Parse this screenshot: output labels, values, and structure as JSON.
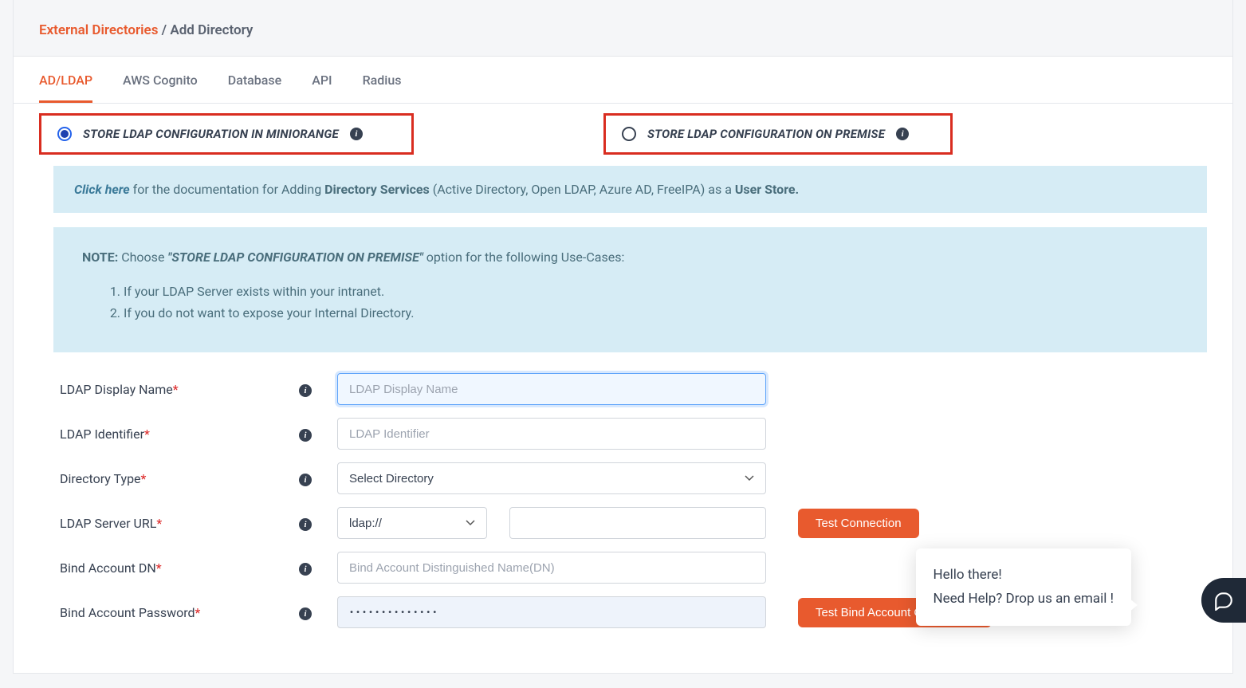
{
  "breadcrumb": {
    "link": "External Directories",
    "sep": " / ",
    "current": "Add Directory"
  },
  "tabs": [
    {
      "label": "AD/LDAP",
      "active": true
    },
    {
      "label": "AWS Cognito",
      "active": false
    },
    {
      "label": "Database",
      "active": false
    },
    {
      "label": "API",
      "active": false
    },
    {
      "label": "Radius",
      "active": false
    }
  ],
  "radios": {
    "mini": "STORE LDAP CONFIGURATION IN MINIORANGE",
    "prem": "STORE LDAP CONFIGURATION ON PREMISE"
  },
  "banner": {
    "click": "Click here",
    "t1": " for the documentation for Adding ",
    "b1": "Directory Services",
    "t2": " (Active Directory, Open LDAP, Azure AD, FreeIPA) as a ",
    "b2": "User Store."
  },
  "note": {
    "head": "NOTE:",
    "lead": "  Choose ",
    "em": "\"STORE LDAP CONFIGURATION ON PREMISE\"",
    "tail": " option for the following Use-Cases:",
    "li1": "If your LDAP Server exists within your intranet.",
    "li2": "If you do not want to expose your Internal Directory."
  },
  "form": {
    "display_label": "LDAP Display Name",
    "display_ph": "LDAP Display Name",
    "ident_label": "LDAP Identifier",
    "ident_ph": "LDAP Identifier",
    "dirtype_label": "Directory Type",
    "dirtype_sel": "Select Directory",
    "url_label": "LDAP Server URL",
    "url_scheme": "ldap://",
    "test_conn": "Test Connection",
    "bind_dn_label": "Bind Account DN",
    "bind_dn_ph": "Bind Account Distinguished Name(DN)",
    "bind_pw_label": "Bind Account Password",
    "bind_pw_val": "••••••••••••••",
    "test_bind": "Test Bind Account Credentials"
  },
  "chat": {
    "l1": "Hello there!",
    "l2": "Need Help? Drop us an email !"
  }
}
